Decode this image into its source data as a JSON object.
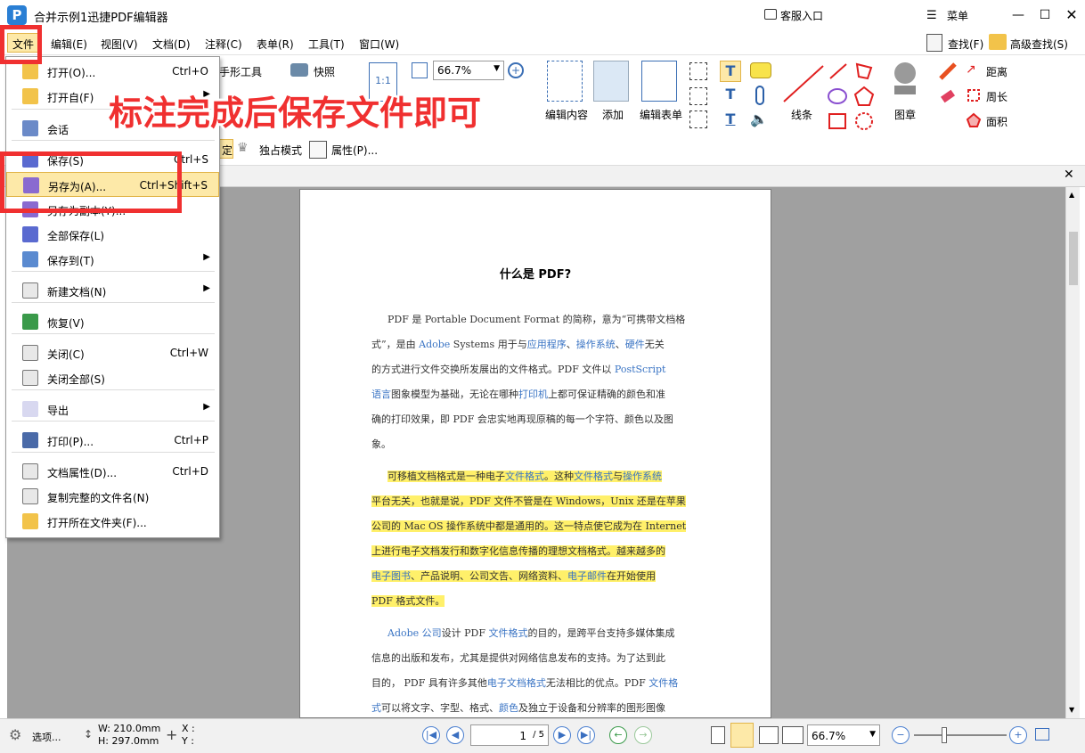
{
  "titlebar": {
    "app_title": "合并示例1迅捷PDF编辑器",
    "customer_service": "客服入口",
    "menu": "菜单"
  },
  "menubar": {
    "items": [
      "文件",
      "编辑(E)",
      "视图(V)",
      "文档(D)",
      "注释(C)",
      "表单(R)",
      "工具(T)",
      "窗口(W)"
    ],
    "find": "查找(F)",
    "advanced_find": "高级查找(S)"
  },
  "ribbon": {
    "hand_tool": "手形工具",
    "snapshot": "快照",
    "zoom_value": "66.7%",
    "edit_content": "编辑内容",
    "add": "添加",
    "edit_form": "编辑表单",
    "lines": "线条",
    "stamp": "图章",
    "distance": "距离",
    "perimeter": "周长",
    "area": "面积",
    "exclusive_mode": "独占模式",
    "properties": "属性(P)...",
    "partial_lock": "定"
  },
  "file_menu": {
    "items": [
      {
        "label": "打开(O)...",
        "shortcut": "Ctrl+O",
        "arrow": false
      },
      {
        "label": "打开自(F)",
        "shortcut": "",
        "arrow": true
      },
      {
        "label": "会话",
        "shortcut": "",
        "arrow": true
      },
      {
        "label": "保存(S)",
        "shortcut": "Ctrl+S",
        "arrow": false
      },
      {
        "label": "另存为(A)...",
        "shortcut": "Ctrl+Shift+S",
        "arrow": false
      },
      {
        "label": "另存为副本(Y)...",
        "shortcut": "",
        "arrow": false
      },
      {
        "label": "全部保存(L)",
        "shortcut": "",
        "arrow": false
      },
      {
        "label": "保存到(T)",
        "shortcut": "",
        "arrow": true
      },
      {
        "label": "新建文档(N)",
        "shortcut": "",
        "arrow": true
      },
      {
        "label": "恢复(V)",
        "shortcut": "",
        "arrow": false
      },
      {
        "label": "关闭(C)",
        "shortcut": "Ctrl+W",
        "arrow": false
      },
      {
        "label": "关闭全部(S)",
        "shortcut": "",
        "arrow": false
      },
      {
        "label": "导出",
        "shortcut": "",
        "arrow": true
      },
      {
        "label": "打印(P)...",
        "shortcut": "Ctrl+P",
        "arrow": false
      },
      {
        "label": "文档属性(D)...",
        "shortcut": "Ctrl+D",
        "arrow": false
      },
      {
        "label": "复制完整的文件名(N)",
        "shortcut": "",
        "arrow": false
      },
      {
        "label": "打开所在文件夹(F)...",
        "shortcut": "",
        "arrow": false
      }
    ]
  },
  "annotation_text": "标注完成后保存文件即可",
  "document": {
    "title": "什么是 PDF?",
    "p1": [
      [
        {
          "t": "PDF 是 Portable Document Format 的简称，意为“可携带文档格"
        }
      ],
      [
        {
          "t": "式”，是由 "
        },
        {
          "t": "Adobe",
          "l": true
        },
        {
          "t": " Systems 用于与"
        },
        {
          "t": "应用程序",
          "l": true
        },
        {
          "t": "、"
        },
        {
          "t": "操作系统",
          "l": true
        },
        {
          "t": "、"
        },
        {
          "t": "硬件",
          "l": true
        },
        {
          "t": "无关"
        }
      ],
      [
        {
          "t": "的方式进行文件交换所发展出的文件格式。PDF 文件以 "
        },
        {
          "t": "PostScript",
          "l": true
        }
      ],
      [
        {
          "t": "语言",
          "l": true
        },
        {
          "t": "图象模型为基础，无论在哪种"
        },
        {
          "t": "打印机",
          "l": true
        },
        {
          "t": "上都可保证精确的颜色和准"
        }
      ],
      [
        {
          "t": "确的打印效果，即 PDF 会忠实地再现原稿的每一个字符、颜色以及图"
        }
      ],
      [
        {
          "t": "象。"
        }
      ]
    ],
    "p2": [
      [
        {
          "t": "可移植文档格式是一种电子"
        },
        {
          "t": "文件格式",
          "l": true
        },
        {
          "t": "。这种"
        },
        {
          "t": "文件格式",
          "l": true
        },
        {
          "t": "与"
        },
        {
          "t": "操作系统",
          "l": true
        }
      ],
      [
        {
          "t": "平台无关，也就是说，PDF 文件不管是在 Windows，Unix 还是在苹果"
        }
      ],
      [
        {
          "t": "公司的 Mac OS 操作系统中都是通用的。这一特点使它成为在 Internet"
        }
      ],
      [
        {
          "t": "上进行电子文档发行和数字化信息传播的理想文档格式。越来越多的"
        }
      ],
      [
        {
          "t": "电子图书",
          "l": true
        },
        {
          "t": "、产品说明、公司文告、网络资料、"
        },
        {
          "t": "电子邮件",
          "l": true
        },
        {
          "t": "在开始使用"
        }
      ],
      [
        {
          "t": "PDF 格式文件。"
        }
      ]
    ],
    "p3": [
      [
        {
          "t": "Adobe 公司",
          "l": true
        },
        {
          "t": "设计 PDF "
        },
        {
          "t": "文件格式",
          "l": true
        },
        {
          "t": "的目的，是跨平台支持多媒体集成"
        }
      ],
      [
        {
          "t": "信息的出版和发布，尤其是提供对网络信息发布的支持。为了达到此"
        }
      ],
      [
        {
          "t": "目的， PDF 具有许多其他"
        },
        {
          "t": "电子文档格式",
          "l": true
        },
        {
          "t": "无法相比的优点。PDF "
        },
        {
          "t": "文件格",
          "l": true
        }
      ],
      [
        {
          "t": "式",
          "l": true
        },
        {
          "t": "可以将文字、字型、格式、"
        },
        {
          "t": "颜色",
          "l": true
        },
        {
          "t": "及独立于设备和分辨率的图形图像"
        }
      ]
    ]
  },
  "statusbar": {
    "options": "选项...",
    "width": "W: 210.0mm",
    "height": "H: 297.0mm",
    "x": "X :",
    "y": "Y :",
    "page_value": "1",
    "page_total": "/ 5",
    "zoom_value": "66.7%"
  },
  "colors": {
    "highlight": "#fff06a",
    "link": "#3a74c4",
    "annotation_red": "#f03030",
    "menu_hover": "#fde9a8"
  }
}
